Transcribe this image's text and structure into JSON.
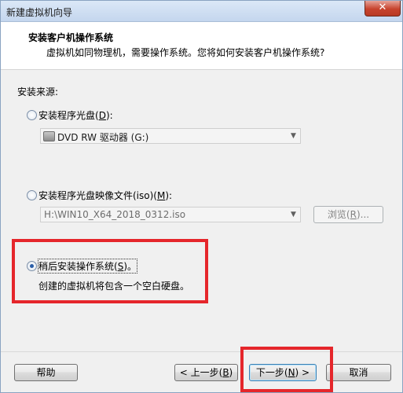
{
  "window": {
    "title": "新建虚拟机向导",
    "close_glyph": "✕"
  },
  "header": {
    "title": "安装客户机操作系统",
    "subtitle": "虚拟机如同物理机，需要操作系统。您将如何安装客户机操作系统?"
  },
  "source": {
    "label": "安装来源:",
    "disc": {
      "label_prefix": "安装程序光盘(",
      "accel": "D",
      "label_suffix": "):",
      "checked": false,
      "drive_value": "DVD RW 驱动器 (G:)"
    },
    "iso": {
      "label_prefix": "安装程序光盘映像文件(iso)(",
      "accel": "M",
      "label_suffix": "):",
      "checked": false,
      "path_value": "H:\\WIN10_X64_2018_0312.iso",
      "browse_prefix": "浏览(",
      "browse_accel": "R",
      "browse_suffix": ")..."
    },
    "later": {
      "label_prefix": "稍后安装操作系统(",
      "accel": "S",
      "label_suffix": ")。",
      "checked": true,
      "description": "创建的虚拟机将包含一个空白硬盘。"
    }
  },
  "buttons": {
    "help": "帮助",
    "back_prefix": "< 上一步(",
    "back_accel": "B",
    "back_suffix": ")",
    "next_prefix": "下一步(",
    "next_accel": "N",
    "next_suffix": ") >",
    "cancel": "取消"
  },
  "colors": {
    "annotation_red": "#e5262b",
    "radio_selected": "#2a5ea8"
  }
}
